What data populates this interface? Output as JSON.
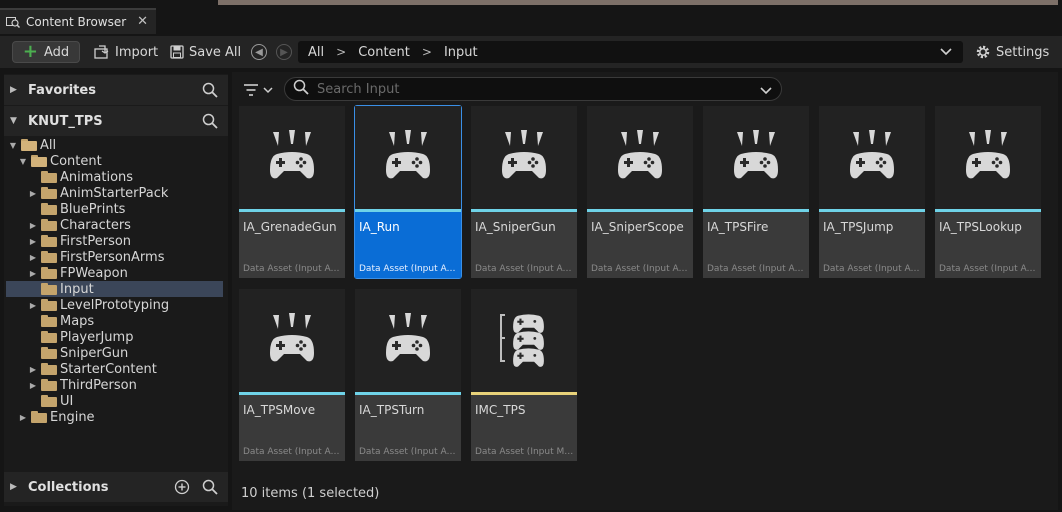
{
  "window": {
    "tab_title": "Content Browser",
    "tab_close": "✕"
  },
  "toolbar": {
    "add_label": "Add",
    "import_label": "Import",
    "saveall_label": "Save All",
    "settings_label": "Settings",
    "breadcrumb": [
      "All",
      "Content",
      "Input"
    ],
    "breadcrumb_sep": ">"
  },
  "left": {
    "favorites_label": "Favorites",
    "project_label": "KNUT_TPS",
    "collections_label": "Collections",
    "tree": [
      {
        "label": "All",
        "depth": 0,
        "expanded": true,
        "folder": "open"
      },
      {
        "label": "Content",
        "depth": 1,
        "expanded": true,
        "folder": "open"
      },
      {
        "label": "Animations",
        "depth": 2,
        "expandable": false
      },
      {
        "label": "AnimStarterPack",
        "depth": 2,
        "expandable": true
      },
      {
        "label": "BluePrints",
        "depth": 2,
        "expandable": false
      },
      {
        "label": "Characters",
        "depth": 2,
        "expandable": true
      },
      {
        "label": "FirstPerson",
        "depth": 2,
        "expandable": true
      },
      {
        "label": "FirstPersonArms",
        "depth": 2,
        "expandable": true
      },
      {
        "label": "FPWeapon",
        "depth": 2,
        "expandable": true
      },
      {
        "label": "Input",
        "depth": 2,
        "expandable": false,
        "selected": true
      },
      {
        "label": "LevelPrototyping",
        "depth": 2,
        "expandable": true
      },
      {
        "label": "Maps",
        "depth": 2,
        "expandable": false
      },
      {
        "label": "PlayerJump",
        "depth": 2,
        "expandable": false
      },
      {
        "label": "SniperGun",
        "depth": 2,
        "expandable": false
      },
      {
        "label": "StarterContent",
        "depth": 2,
        "expandable": true
      },
      {
        "label": "ThirdPerson",
        "depth": 2,
        "expandable": true
      },
      {
        "label": "UI",
        "depth": 2,
        "expandable": false
      },
      {
        "label": "Engine",
        "depth": 1,
        "expandable": true
      }
    ]
  },
  "right": {
    "search_placeholder": "Search Input",
    "assets": [
      {
        "name": "IA_GrenadeGun",
        "type": "Data Asset (Input Acti…",
        "icon": "gamepad-icon",
        "bar": "cyan"
      },
      {
        "name": "IA_Run",
        "type": "Data Asset (Input Acti…",
        "icon": "gamepad-icon",
        "bar": "cyan",
        "selected": true
      },
      {
        "name": "IA_SniperGun",
        "type": "Data Asset (Input Acti…",
        "icon": "gamepad-icon",
        "bar": "cyan"
      },
      {
        "name": "IA_SniperScope",
        "type": "Data Asset (Input Acti…",
        "icon": "gamepad-icon",
        "bar": "cyan"
      },
      {
        "name": "IA_TPSFire",
        "type": "Data Asset (Input Acti…",
        "icon": "gamepad-icon",
        "bar": "cyan"
      },
      {
        "name": "IA_TPSJump",
        "type": "Data Asset (Input Acti…",
        "icon": "gamepad-icon",
        "bar": "cyan"
      },
      {
        "name": "IA_TPSLookup",
        "type": "Data Asset (Input Acti…",
        "icon": "gamepad-icon",
        "bar": "cyan"
      },
      {
        "name": "IA_TPSMove",
        "type": "Data Asset (Input Acti…",
        "icon": "gamepad-icon",
        "bar": "cyan"
      },
      {
        "name": "IA_TPSTurn",
        "type": "Data Asset (Input Acti…",
        "icon": "gamepad-icon",
        "bar": "cyan"
      },
      {
        "name": "IMC_TPS",
        "type": "Data Asset (Input Map…",
        "icon": "mapping-context-icon",
        "bar": "yellow"
      }
    ],
    "status": "10 items (1 selected)"
  },
  "colors": {
    "accent_blue": "#0a6dd6",
    "input_action_bar": "#6fd3e8",
    "mapping_context_bar": "#e8d27a",
    "folder": "#c4a46c"
  }
}
